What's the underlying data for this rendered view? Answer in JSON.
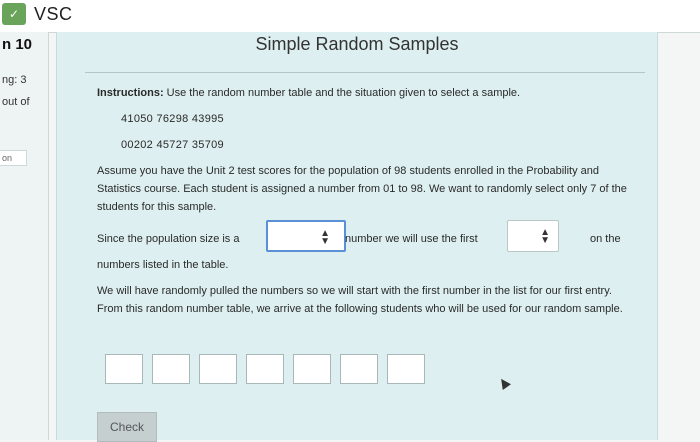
{
  "app": {
    "name": "VSC"
  },
  "sidebar": {
    "top_label": "n 10",
    "score_label": "ng: 3",
    "out_of_label": "out of",
    "bottom_label": "on"
  },
  "page": {
    "title": "Simple Random Samples",
    "instructions_label": "Instructions:",
    "instructions_text": " Use the random number table and the situation given to select a sample.",
    "random_row_1": "41050 76298 43995",
    "random_row_2": "00202 45727 35709",
    "scenario": "Assume you have the Unit 2 test scores for the population of 98 students enrolled in the Probability and Statistics course. Each student is assigned a number from 01 to 98. We want to randomly select only 7 of the students for this sample.",
    "sentence_part_1": "Since the population size is a",
    "sentence_part_2": "number we will use the first",
    "sentence_part_3": "on the",
    "sentence_part_4": "numbers listed in the table.",
    "paragraph_2": "We will have randomly pulled the numbers so we will start with the first number in the list for our first entry. From this random number table, we arrive at the following students who will be used for our random sample.",
    "check_label": "Check"
  },
  "dropdown_1": {
    "selected": ""
  },
  "dropdown_2": {
    "selected": ""
  },
  "answer_boxes": [
    "",
    "",
    "",
    "",
    "",
    "",
    ""
  ]
}
